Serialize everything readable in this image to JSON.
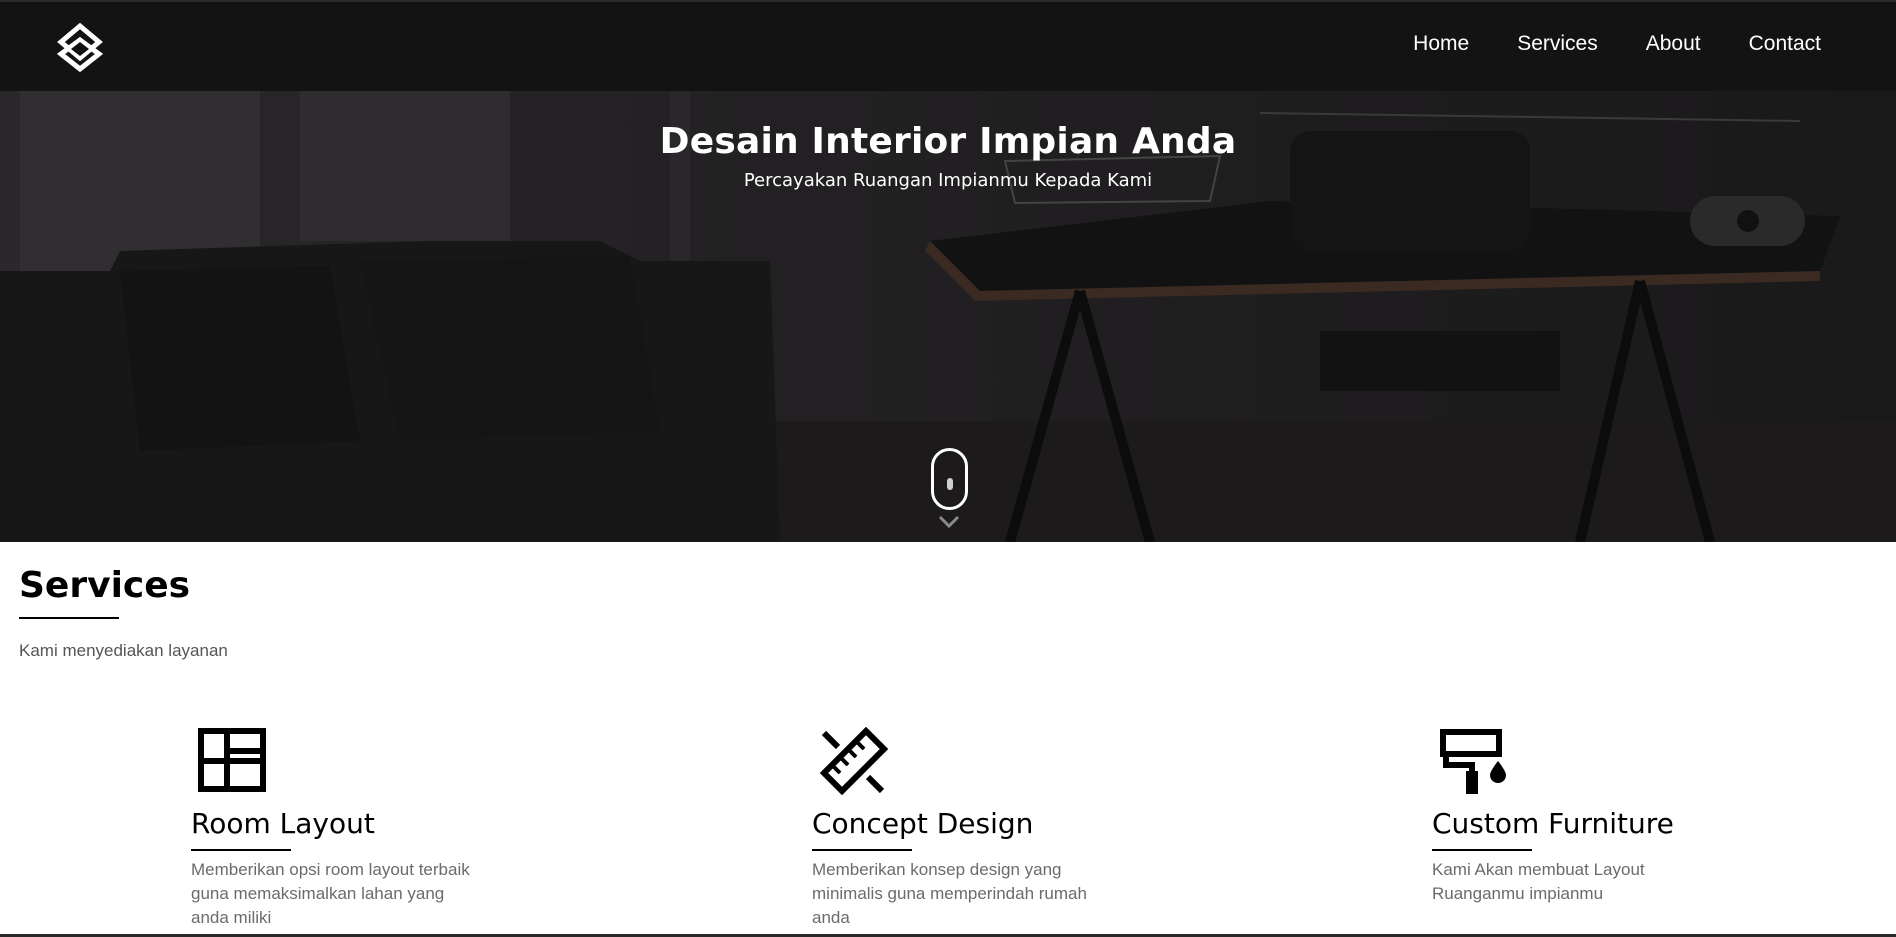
{
  "nav": {
    "logo_icon": "interlocked-cube-logo-icon",
    "links": [
      "Home",
      "Services",
      "About",
      "Contact"
    ]
  },
  "hero": {
    "title": "Desain Interior Impian Anda",
    "subtitle": "Percayakan Ruangan Impianmu Kepada Kami",
    "scroll_icon": "mouse-scroll-icon",
    "chevron_icon": "chevron-down-icon"
  },
  "services": {
    "heading": "Services",
    "description": "Kami menyediakan layanan",
    "items": [
      {
        "icon": "room-layout-icon",
        "title": "Room Layout",
        "description": "Memberikan opsi room layout terbaik guna memaksimalkan lahan yang anda miliki"
      },
      {
        "icon": "ruler-pencil-icon",
        "title": "Concept Design",
        "description": "Memberikan konsep design yang minimalis guna memperindah rumah anda"
      },
      {
        "icon": "paint-roller-icon",
        "title": "Custom Furniture",
        "description": "Kami Akan membuat Layout Ruanganmu impianmu"
      }
    ]
  },
  "colors": {
    "navbar_bg": "#131313",
    "hero_overlay": "#1c1b1c",
    "text_primary": "#000000",
    "text_muted": "#6b6b6b"
  }
}
